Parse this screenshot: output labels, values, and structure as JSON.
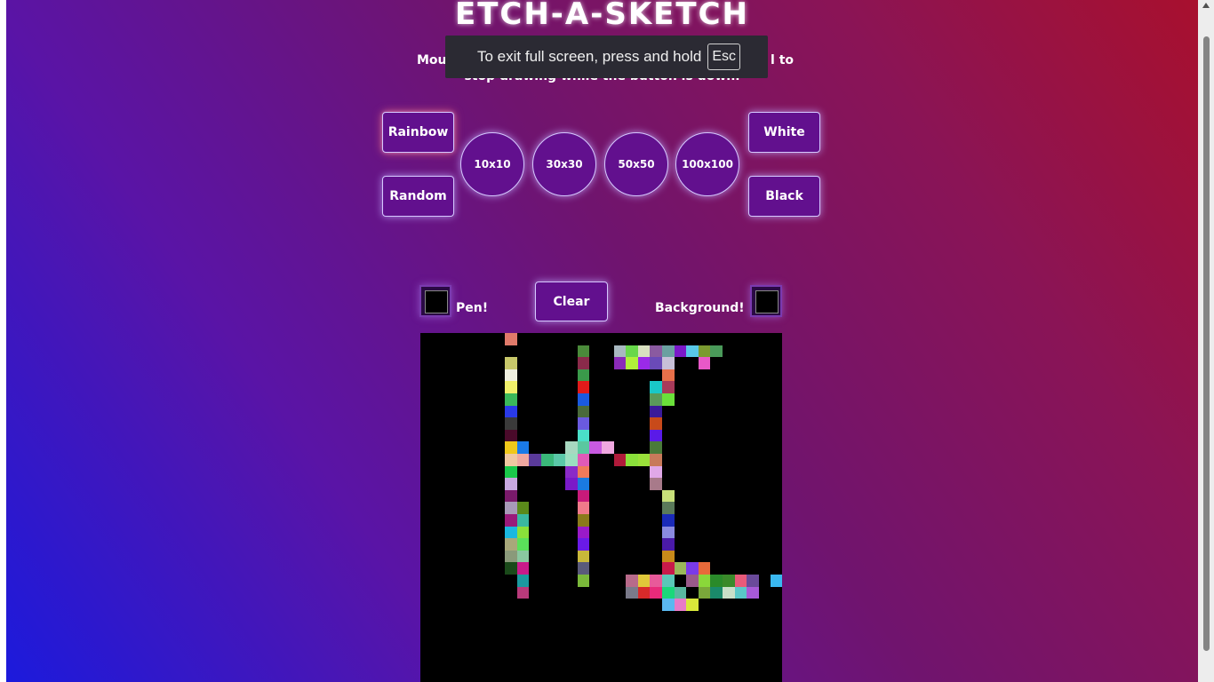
{
  "app": {
    "title": "ETCH-A-SKETCH",
    "instructions_prefix": "Mous",
    "instructions_suffix": "l to",
    "instructions_line2": "stop drawing while the button is down."
  },
  "controls": {
    "rainbow": "Rainbow",
    "random": "Random",
    "white": "White",
    "black": "Black",
    "grid_sizes": [
      "10x10",
      "30x30",
      "50x50",
      "100x100"
    ],
    "pen_label": "Pen!",
    "clear": "Clear",
    "background_label": "Background!",
    "pen_color": "#000000",
    "background_color": "#000000"
  },
  "fullscreen_toast": {
    "message": "To exit full screen, press and hold",
    "key": "Esc"
  },
  "canvas": {
    "grid": "30x30",
    "background": "#000000",
    "painted_cells": [
      [
        7,
        0,
        "#e07a6a"
      ],
      [
        13,
        1,
        "#4a8a3a"
      ],
      [
        16,
        1,
        "#a8b8c0"
      ],
      [
        17,
        1,
        "#68d84a"
      ],
      [
        18,
        1,
        "#d8e0c0"
      ],
      [
        19,
        1,
        "#8a5aa0"
      ],
      [
        20,
        1,
        "#6aa0a0"
      ],
      [
        21,
        1,
        "#7a1ac8"
      ],
      [
        22,
        1,
        "#58c8e8"
      ],
      [
        23,
        1,
        "#7a9a30"
      ],
      [
        24,
        1,
        "#4a9a5a"
      ],
      [
        7,
        2,
        "#c8c86a"
      ],
      [
        13,
        2,
        "#8a2a4a"
      ],
      [
        16,
        2,
        "#8a2ab8"
      ],
      [
        17,
        2,
        "#b0f03a"
      ],
      [
        18,
        2,
        "#9a2ae8"
      ],
      [
        19,
        2,
        "#6a4ab8"
      ],
      [
        20,
        2,
        "#c8c0d8"
      ],
      [
        23,
        2,
        "#e858c8"
      ],
      [
        7,
        3,
        "#f0f0e0"
      ],
      [
        13,
        3,
        "#3a9a4a"
      ],
      [
        20,
        3,
        "#e8704a"
      ],
      [
        7,
        4,
        "#f0f06a"
      ],
      [
        13,
        4,
        "#e01a1a"
      ],
      [
        19,
        4,
        "#1ac8c8"
      ],
      [
        20,
        4,
        "#a83a5a"
      ],
      [
        7,
        5,
        "#3ab85a"
      ],
      [
        13,
        5,
        "#1a5ae0"
      ],
      [
        19,
        5,
        "#5a9a5a"
      ],
      [
        20,
        5,
        "#6ae03a"
      ],
      [
        7,
        6,
        "#2a3ae8"
      ],
      [
        13,
        6,
        "#4a6a3a"
      ],
      [
        19,
        6,
        "#3a1a9a"
      ],
      [
        7,
        7,
        "#3a3a3a"
      ],
      [
        13,
        7,
        "#6a5ae0"
      ],
      [
        19,
        7,
        "#c84a1a"
      ],
      [
        7,
        8,
        "#4a0a2a"
      ],
      [
        13,
        8,
        "#4ae0c8"
      ],
      [
        19,
        8,
        "#5a1ae8"
      ],
      [
        7,
        9,
        "#f0c81a"
      ],
      [
        8,
        9,
        "#1a7ae8"
      ],
      [
        12,
        9,
        "#a8d8c0"
      ],
      [
        13,
        9,
        "#5ac8a0"
      ],
      [
        14,
        9,
        "#c85ae0"
      ],
      [
        15,
        9,
        "#f0a8e0"
      ],
      [
        19,
        9,
        "#4a7a3a"
      ],
      [
        7,
        10,
        "#f0c8a0"
      ],
      [
        8,
        10,
        "#f0a8a0"
      ],
      [
        9,
        10,
        "#5a3a9a"
      ],
      [
        10,
        10,
        "#3ab87a"
      ],
      [
        11,
        10,
        "#5ac8a8"
      ],
      [
        12,
        10,
        "#9ae0c0"
      ],
      [
        13,
        10,
        "#e05ab8"
      ],
      [
        16,
        10,
        "#b01a3a"
      ],
      [
        17,
        10,
        "#8ae03a"
      ],
      [
        18,
        10,
        "#9ae03a"
      ],
      [
        19,
        10,
        "#c87a5a"
      ],
      [
        7,
        11,
        "#1ac84a"
      ],
      [
        12,
        11,
        "#8a2ac8"
      ],
      [
        13,
        11,
        "#f07a5a"
      ],
      [
        19,
        11,
        "#e0a8e8"
      ],
      [
        7,
        12,
        "#c8a8e0"
      ],
      [
        12,
        12,
        "#7a1ac8"
      ],
      [
        13,
        12,
        "#1a7ae0"
      ],
      [
        19,
        12,
        "#a87a8a"
      ],
      [
        7,
        13,
        "#7a1a6a"
      ],
      [
        13,
        13,
        "#c81a7a"
      ],
      [
        20,
        13,
        "#c8e07a"
      ],
      [
        7,
        14,
        "#a89ab8"
      ],
      [
        8,
        14,
        "#5a8a1a"
      ],
      [
        13,
        14,
        "#f07a8a"
      ],
      [
        20,
        14,
        "#5a7a5a"
      ],
      [
        7,
        15,
        "#9a1a7a"
      ],
      [
        8,
        15,
        "#3ab8a0"
      ],
      [
        13,
        15,
        "#8a7a1a"
      ],
      [
        20,
        15,
        "#1a2ab8"
      ],
      [
        7,
        16,
        "#1ab8e0"
      ],
      [
        8,
        16,
        "#8ae03a"
      ],
      [
        13,
        16,
        "#9a1ac8"
      ],
      [
        20,
        16,
        "#8a8ae0"
      ],
      [
        7,
        17,
        "#a8a87a"
      ],
      [
        8,
        17,
        "#5ae05a"
      ],
      [
        13,
        17,
        "#6a1ae8"
      ],
      [
        20,
        17,
        "#4a1aa8"
      ],
      [
        7,
        18,
        "#8a9a7a"
      ],
      [
        8,
        18,
        "#8ac8a0"
      ],
      [
        13,
        18,
        "#c8b83a"
      ],
      [
        20,
        18,
        "#c88a1a"
      ],
      [
        7,
        19,
        "#1a4a1a"
      ],
      [
        8,
        19,
        "#c81a8a"
      ],
      [
        13,
        19,
        "#5a5a7a"
      ],
      [
        20,
        19,
        "#c81a4a"
      ],
      [
        21,
        19,
        "#9ab85a"
      ],
      [
        22,
        19,
        "#7a3ae8"
      ],
      [
        23,
        19,
        "#e86a3a"
      ],
      [
        8,
        20,
        "#1a9aa0"
      ],
      [
        13,
        20,
        "#7ab83a"
      ],
      [
        17,
        20,
        "#b86a8a"
      ],
      [
        18,
        20,
        "#e0c83a"
      ],
      [
        19,
        20,
        "#e85a9a"
      ],
      [
        20,
        20,
        "#5ac8b8"
      ],
      [
        22,
        20,
        "#9a5a8a"
      ],
      [
        23,
        20,
        "#8ad83a"
      ],
      [
        24,
        20,
        "#2a8a2a"
      ],
      [
        25,
        20,
        "#3a8a2a"
      ],
      [
        26,
        20,
        "#e85a7a"
      ],
      [
        27,
        20,
        "#6a4a9a"
      ],
      [
        29,
        20,
        "#3ab8f0"
      ],
      [
        8,
        21,
        "#b83a7a"
      ],
      [
        17,
        21,
        "#7a7a8a"
      ],
      [
        18,
        21,
        "#d82a2a"
      ],
      [
        19,
        21,
        "#e82a7a"
      ],
      [
        20,
        21,
        "#1ad87a"
      ],
      [
        21,
        21,
        "#5ab8a0"
      ],
      [
        23,
        21,
        "#7aa83a"
      ],
      [
        24,
        21,
        "#1a8a6a"
      ],
      [
        25,
        21,
        "#c8e0c8"
      ],
      [
        26,
        21,
        "#5ac8c8"
      ],
      [
        27,
        21,
        "#a85ad8"
      ],
      [
        20,
        22,
        "#5ab8f0"
      ],
      [
        21,
        22,
        "#e87ac8"
      ],
      [
        22,
        22,
        "#d8e83a"
      ]
    ]
  },
  "colors": {
    "accent": "#62108e",
    "glow": "#d6c8ff",
    "gradient_start": "#1c1adc",
    "gradient_end": "#a8102e"
  }
}
